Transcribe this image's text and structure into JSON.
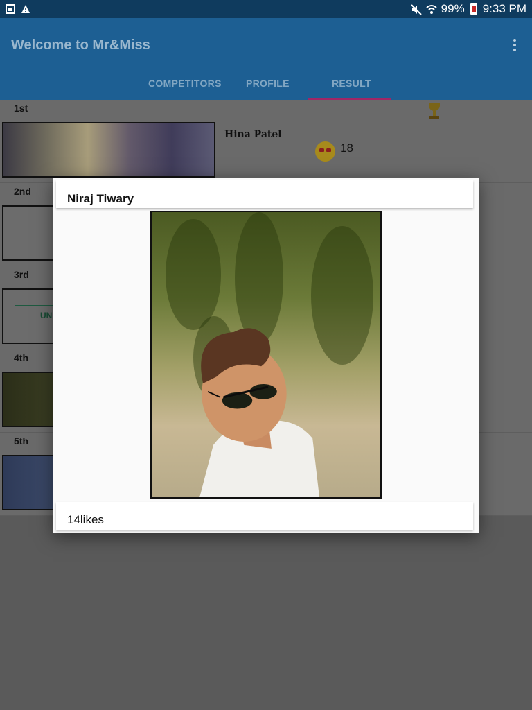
{
  "status_bar": {
    "battery_percent": "99%",
    "time": "9:33 PM",
    "icons": [
      "image-notification-icon",
      "warning-icon",
      "mute-icon",
      "wifi-icon",
      "battery-icon"
    ]
  },
  "app_bar": {
    "title": "Welcome to Mr&Miss",
    "tabs": [
      {
        "label": "COMPETITORS",
        "active": false
      },
      {
        "label": "PROFILE",
        "active": false
      },
      {
        "label": "RESULT",
        "active": true
      }
    ]
  },
  "results": [
    {
      "rank": "1st",
      "name": "Hina Patel",
      "likes": "18"
    },
    {
      "rank": "2nd"
    },
    {
      "rank": "3rd",
      "button_text": "UNI"
    },
    {
      "rank": "4th"
    },
    {
      "rank": "5th"
    }
  ],
  "dialog": {
    "title": "Niraj Tiwary",
    "likes_text": "14likes"
  },
  "colors": {
    "status_bar": "#0f3b5e",
    "app_bar": "#1d5f93",
    "tab_indicator": "#c2185b"
  }
}
